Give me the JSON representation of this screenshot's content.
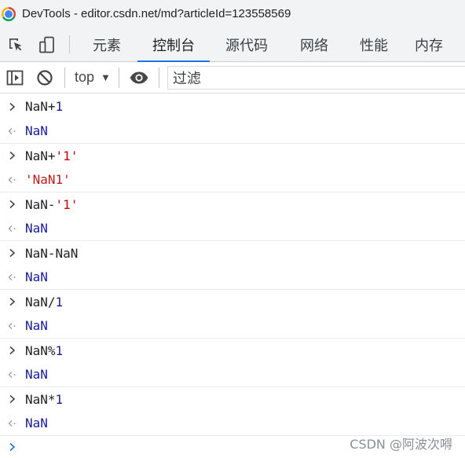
{
  "window": {
    "title": "DevTools - editor.csdn.net/md?articleId=123558569"
  },
  "tabs": [
    {
      "label": "元素",
      "active": false
    },
    {
      "label": "控制台",
      "active": true
    },
    {
      "label": "源代码",
      "active": false
    },
    {
      "label": "网络",
      "active": false
    },
    {
      "label": "性能",
      "active": false
    },
    {
      "label": "内存",
      "active": false
    }
  ],
  "toolbar": {
    "context": "top",
    "filter_placeholder": "过滤"
  },
  "console": {
    "entries": [
      {
        "input": [
          {
            "text": "NaN+",
            "kind": "plain"
          },
          {
            "text": "1",
            "kind": "num"
          }
        ],
        "result": {
          "text": "NaN",
          "kind": "nan"
        }
      },
      {
        "input": [
          {
            "text": "NaN+",
            "kind": "plain"
          },
          {
            "text": "'1'",
            "kind": "str"
          }
        ],
        "result": {
          "text": "'NaN1'",
          "kind": "strres"
        }
      },
      {
        "input": [
          {
            "text": "NaN-",
            "kind": "plain"
          },
          {
            "text": "'1'",
            "kind": "str"
          }
        ],
        "result": {
          "text": "NaN",
          "kind": "nan"
        }
      },
      {
        "input": [
          {
            "text": "NaN-NaN",
            "kind": "plain"
          }
        ],
        "result": {
          "text": "NaN",
          "kind": "nan"
        }
      },
      {
        "input": [
          {
            "text": "NaN/",
            "kind": "plain"
          },
          {
            "text": "1",
            "kind": "num"
          }
        ],
        "result": {
          "text": "NaN",
          "kind": "nan"
        }
      },
      {
        "input": [
          {
            "text": "NaN%",
            "kind": "plain"
          },
          {
            "text": "1",
            "kind": "num"
          }
        ],
        "result": {
          "text": "NaN",
          "kind": "nan"
        }
      },
      {
        "input": [
          {
            "text": "NaN*",
            "kind": "plain"
          },
          {
            "text": "1",
            "kind": "num"
          }
        ],
        "result": {
          "text": "NaN",
          "kind": "nan"
        }
      }
    ]
  },
  "watermark": "CSDN @阿波次嘚",
  "colors": {
    "accent": "#1a73e8",
    "number": "#1a1aa6",
    "string": "#c80000"
  }
}
